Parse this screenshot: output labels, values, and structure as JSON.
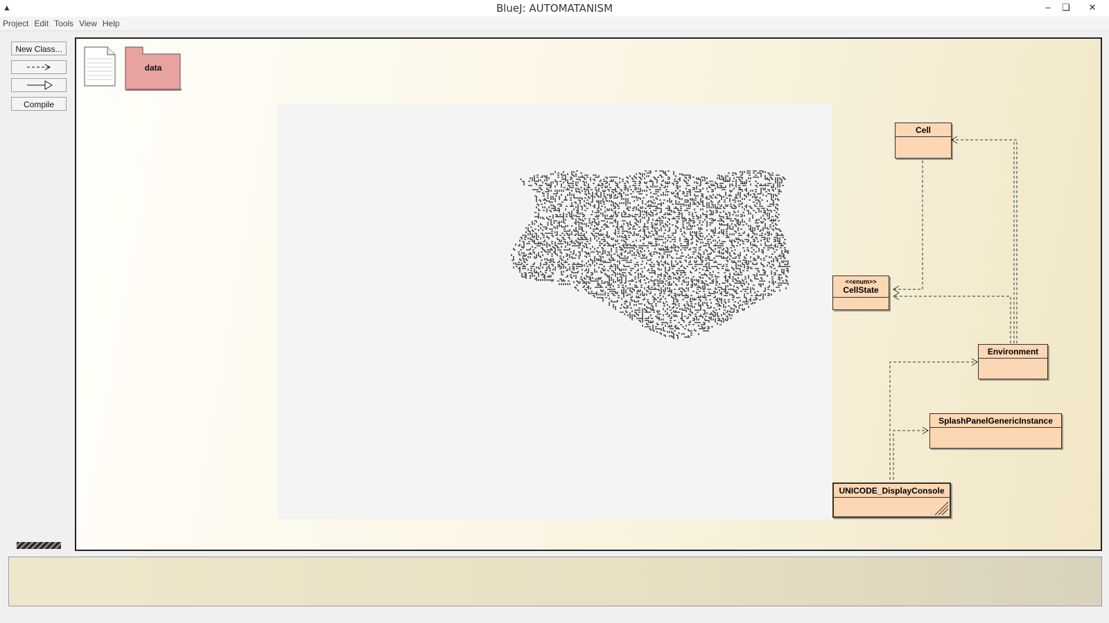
{
  "window": {
    "title": "BlueJ:  AUTOMATANISM",
    "controls": {
      "minimize": "–",
      "maximize": "❏",
      "close": "✕"
    }
  },
  "menu": {
    "items": [
      "Project",
      "Edit",
      "Tools",
      "View",
      "Help"
    ]
  },
  "toolbar": {
    "new_class": "New Class...",
    "uses_arrow": "--->",
    "inherit_arrow": "—▷",
    "compile": "Compile"
  },
  "diagram": {
    "package": {
      "label": "data"
    },
    "classes": {
      "cell": "Cell",
      "cellstate_stereotype": "<<enum>>",
      "cellstate": "CellState",
      "environment": "Environment",
      "splash": "SplashPanelGenericInstance",
      "display": "UNICODE_DisplayConsole"
    }
  },
  "message": "",
  "colors": {
    "class_fill": "#fbd7b3",
    "package_fill": "#e8a3a0",
    "canvas_bg": "#fbf6e6"
  }
}
